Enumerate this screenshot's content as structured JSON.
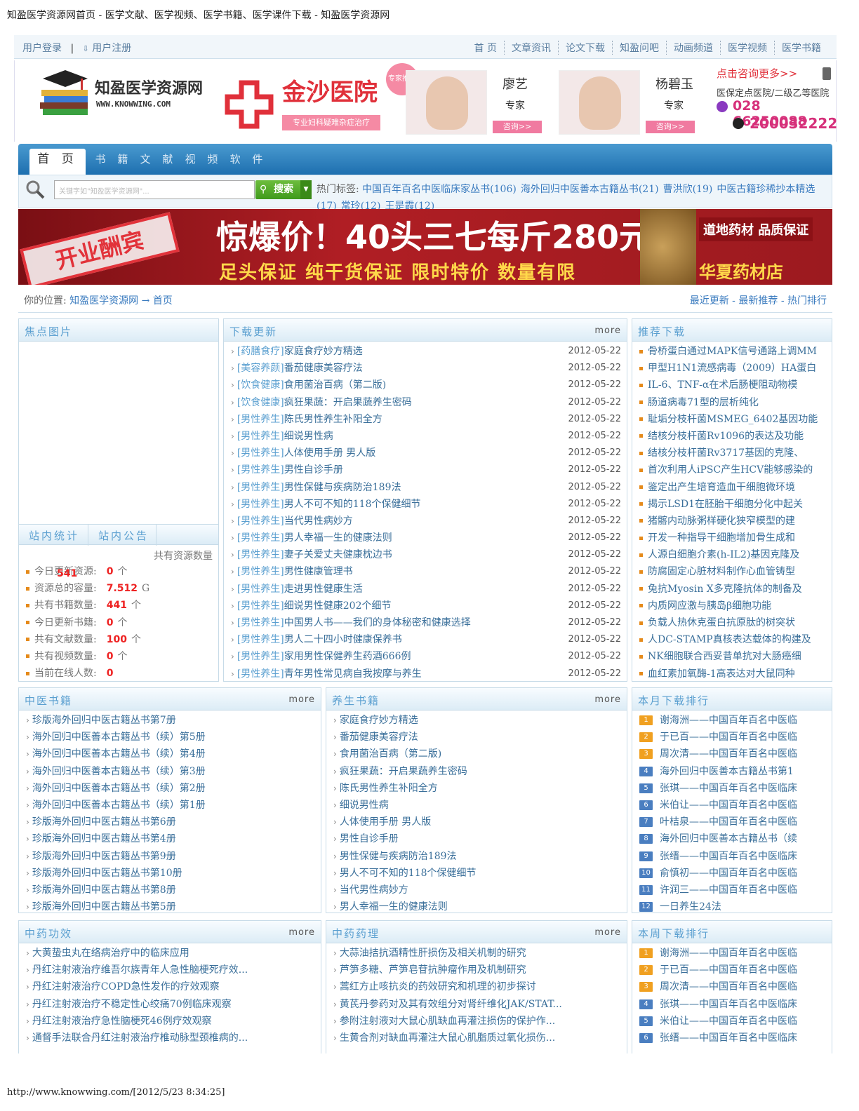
{
  "page_title": "知盈医学资源网首页 - 医学文献、医学视频、医学书籍、医学课件下载 - 知盈医学资源网",
  "footer_url": "http://www.knowwing.com/[2012/5/23 8:34:25]",
  "topbar": {
    "login": "用户登录",
    "sep": "|",
    "register": "用户注册",
    "links": [
      "首 页",
      "文章资讯",
      "论文下载",
      "知盈问吧",
      "动画频道",
      "医学视频",
      "医学书籍"
    ]
  },
  "logo": {
    "name": "知盈医学资源网",
    "url": "WWW.KNOWWING.COM"
  },
  "ad_hospital": {
    "name": "金沙医院",
    "sub": "专业妇科疑难杂症治疗",
    "badge": "专家推荐",
    "doctors": [
      {
        "name": "廖艺",
        "title": "专家",
        "button": "咨询>>"
      },
      {
        "name": "杨碧玉",
        "title": "专家",
        "button": "咨询>>"
      }
    ],
    "more": "点击咨询更多>>",
    "level": "医保定点医院/二级乙等医院",
    "tel": "028 66250088",
    "qq": "200032222"
  },
  "nav": {
    "tabs": [
      "首 页",
      "书 籍",
      "文 献",
      "视 频",
      "软 件"
    ]
  },
  "search": {
    "placeholder": "关键字如\"知盈医学资源网\"...",
    "button": "搜索",
    "tags_label": "热门标签:",
    "tags": [
      "中国百年百名中医临床家丛书(106)",
      "海外回归中医善本古籍丛书(21)",
      "曹洪欣(19)",
      "中医古籍珍稀抄本精选(17)",
      "常玲(12)",
      "王是霞(12)"
    ]
  },
  "banner": {
    "stamp": "开业酬宾",
    "headline": "惊爆价！40头三七每斤280元",
    "sub": "足头保证 纯干货保证 限时特价 数量有限",
    "tag": "道地药材 品质保证",
    "store": "华夏药材店"
  },
  "location": {
    "label": "你的位置:",
    "site": "知盈医学资源网",
    "arrow": "→",
    "page": "首页",
    "right": "最近更新 - 最新推荐 - 热门排行"
  },
  "focus": {
    "title": "焦点图片"
  },
  "stats": {
    "tab1": "站内统计",
    "tab2": "站内公告",
    "header": "共有资源数量",
    "rows": [
      {
        "label": "今日更新资源:",
        "value": "0",
        "unit": "个",
        "over": "541"
      },
      {
        "label": "资源总的容量:",
        "value": "7.512",
        "unit": "G"
      },
      {
        "label": "共有书籍数量:",
        "value": "441",
        "unit": "个"
      },
      {
        "label": "今日更新书籍:",
        "value": "0",
        "unit": "个"
      },
      {
        "label": "共有文献数量:",
        "value": "100",
        "unit": "个"
      },
      {
        "label": "共有视频数量:",
        "value": "0",
        "unit": "个"
      },
      {
        "label": "当前在线人数:",
        "value": "0",
        "unit": ""
      }
    ]
  },
  "downloads": {
    "title": "下载更新",
    "more": "more",
    "items": [
      {
        "cat": "[药膳食疗]",
        "title": "家庭食疗妙方精选",
        "date": "2012-05-22"
      },
      {
        "cat": "[美容养颜]",
        "title": "番茄健康美容疗法",
        "date": "2012-05-22"
      },
      {
        "cat": "[饮食健康]",
        "title": "食用菌治百病（第二版)",
        "date": "2012-05-22"
      },
      {
        "cat": "[饮食健康]",
        "title": "疯狂果蔬：开启果蔬养生密码",
        "date": "2012-05-22"
      },
      {
        "cat": "[男性养生]",
        "title": "陈氏男性养生补阳全方",
        "date": "2012-05-22"
      },
      {
        "cat": "[男性养生]",
        "title": "细说男性病",
        "date": "2012-05-22"
      },
      {
        "cat": "[男性养生]",
        "title": "人体使用手册 男人版",
        "date": "2012-05-22"
      },
      {
        "cat": "[男性养生]",
        "title": "男性自诊手册",
        "date": "2012-05-22"
      },
      {
        "cat": "[男性养生]",
        "title": "男性保健与疾病防治189法",
        "date": "2012-05-22"
      },
      {
        "cat": "[男性养生]",
        "title": "男人不可不知的118个保健细节",
        "date": "2012-05-22"
      },
      {
        "cat": "[男性养生]",
        "title": "当代男性病妙方",
        "date": "2012-05-22"
      },
      {
        "cat": "[男性养生]",
        "title": "男人幸福一生的健康法则",
        "date": "2012-05-22"
      },
      {
        "cat": "[男性养生]",
        "title": "妻子关爱丈夫健康枕边书",
        "date": "2012-05-22"
      },
      {
        "cat": "[男性养生]",
        "title": "男性健康管理书",
        "date": "2012-05-22"
      },
      {
        "cat": "[男性养生]",
        "title": "走进男性健康生活",
        "date": "2012-05-22"
      },
      {
        "cat": "[男性养生]",
        "title": "细说男性健康202个细节",
        "date": "2012-05-22"
      },
      {
        "cat": "[男性养生]",
        "title": "中国男人书——我们的身体秘密和健康选择",
        "date": "2012-05-22"
      },
      {
        "cat": "[男性养生]",
        "title": "男人二十四小时健康保养书",
        "date": "2012-05-22"
      },
      {
        "cat": "[男性养生]",
        "title": "家用男性保健养生药酒666例",
        "date": "2012-05-22"
      },
      {
        "cat": "[男性养生]",
        "title": "青年男性常见病自我按摩与养生",
        "date": "2012-05-22"
      }
    ]
  },
  "recommend": {
    "title": "推荐下载",
    "items": [
      "骨桥蛋白通过MAPK信号通路上调MM",
      "甲型H1N1流感病毒（2009）HA蛋白",
      "IL-6、TNF-α在术后肠梗阻动物模",
      "肠道病毒71型的层析纯化",
      "耻垢分枝杆菌MSMEG_6402基因功能",
      "结核分枝杆菌Rv1096的表达及功能",
      "结核分枝杆菌Rv3717基因的克隆、",
      "首次利用人iPSC产生HCV能够感染的",
      "鉴定出产生培育造血干细胞微环境",
      "揭示LSD1在胚胎干细胞分化中起关",
      "猪髂内动脉粥样硬化狭窄模型的建",
      "开发一种指导干细胞增加骨生成和",
      "人源白细胞介素(h-IL2)基因克隆及",
      "防腐固定心脏材料制作心血管铸型",
      "兔抗Myosin Ⅹ多克隆抗体的制备及",
      "内质网应激与胰岛β细胞功能",
      "负载人热休克蛋白抗原肽的树突状",
      "人DC-STAMP真核表达载体的构建及",
      "NK细胞联合西妥昔单抗对大肠癌细",
      "血红素加氧酶-1高表达对大鼠同种"
    ]
  },
  "tcm_books": {
    "title": "中医书籍",
    "more": "more",
    "items": [
      "珍版海外回归中医古籍丛书第7册",
      "海外回归中医善本古籍丛书（续）第5册",
      "海外回归中医善本古籍丛书（续）第4册",
      "海外回归中医善本古籍丛书（续）第3册",
      "海外回归中医善本古籍丛书（续）第2册",
      "海外回归中医善本古籍丛书（续）第1册",
      "珍版海外回归中医古籍丛书第6册",
      "珍版海外回归中医古籍丛书第4册",
      "珍版海外回归中医古籍丛书第9册",
      "珍版海外回归中医古籍丛书第10册",
      "珍版海外回归中医古籍丛书第8册",
      "珍版海外回归中医古籍丛书第5册"
    ]
  },
  "health_books": {
    "title": "养生书籍",
    "more": "more",
    "items": [
      "家庭食疗妙方精选",
      "番茄健康美容疗法",
      "食用菌治百病（第二版)",
      "疯狂果蔬：开启果蔬养生密码",
      "陈氏男性养生补阳全方",
      "细说男性病",
      "人体使用手册 男人版",
      "男性自诊手册",
      "男性保健与疾病防治189法",
      "男人不可不知的118个保健细节",
      "当代男性病妙方",
      "男人幸福一生的健康法则"
    ]
  },
  "month_rank": {
    "title": "本月下载排行",
    "items": [
      "谢海洲——中国百年百名中医临",
      "于已百——中国百年百名中医临",
      "周次清——中国百年百名中医临",
      "海外回归中医善本古籍丛书第1",
      "张琪——中国百年百名中医临床",
      "米伯让——中国百年百名中医临",
      "叶桔泉——中国百年百名中医临",
      "海外回归中医善本古籍丛书（续",
      "张缙——中国百年百名中医临床",
      "俞慎初——中国百年百名中医临",
      "许润三——中国百年百名中医临",
      "一日养生24法"
    ]
  },
  "herb_effect": {
    "title": "中药功效",
    "more": "more",
    "items": [
      "大黄蛰虫丸在络病治疗中的临床应用",
      "丹红注射液治疗维吾尔族青年人急性脑梗死疗效...",
      "丹红注射液治疗COPD急性发作的疗效观察",
      "丹红注射液治疗不稳定性心绞痛70例临床观察",
      "丹红注射液治疗急性脑梗死46例疗效观察",
      "通督手法联合丹红注射液治疗椎动脉型颈椎病的..."
    ]
  },
  "herb_pharm": {
    "title": "中药药理",
    "more": "more",
    "items": [
      "大蒜油拮抗酒精性肝损伤及相关机制的研究",
      "芦笋多糖、芦笋皂苷抗肿瘤作用及机制研究",
      "蒿红方止咳抗炎的药效研究和机理的初步探讨",
      "黄芪丹参药对及其有效组分对肾纤维化JAK/STAT...",
      "参附注射液对大鼠心肌缺血再灌注损伤的保护作...",
      "生黄合剂对缺血再灌注大鼠心肌脂质过氧化损伤..."
    ]
  },
  "week_rank": {
    "title": "本周下载排行",
    "items": [
      "谢海洲——中国百年百名中医临",
      "于已百——中国百年百名中医临",
      "周次清——中国百年百名中医临",
      "张琪——中国百年百名中医临床",
      "米伯让——中国百年百名中医临",
      "张缙——中国百年百名中医临床"
    ]
  },
  "rank_colors": [
    "#f0a020",
    "#f0a020",
    "#f0a020",
    "#4a7ec0",
    "#4a7ec0",
    "#4a7ec0",
    "#4a7ec0",
    "#4a7ec0",
    "#4a7ec0",
    "#4a7ec0",
    "#4a7ec0",
    "#4a7ec0"
  ]
}
